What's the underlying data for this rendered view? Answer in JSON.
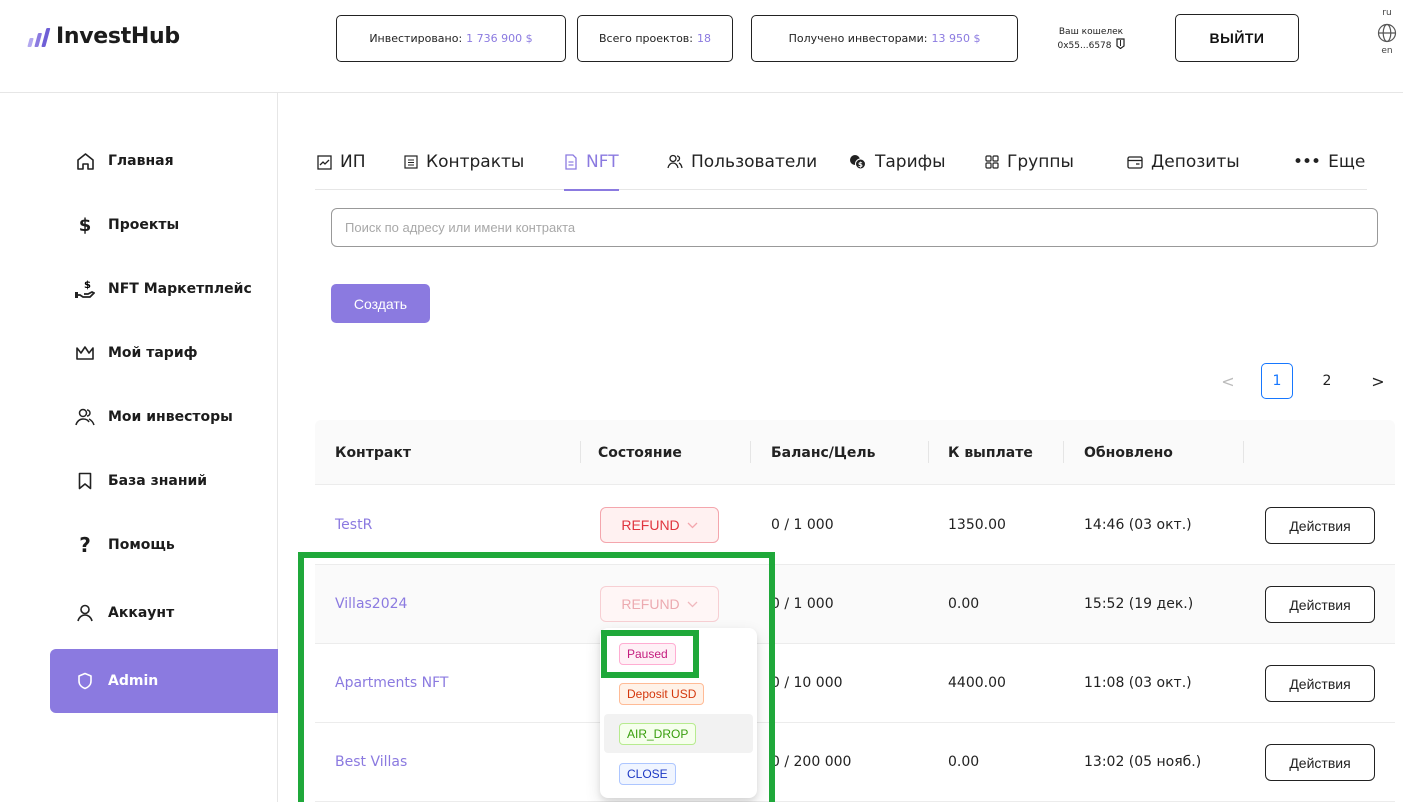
{
  "brand": {
    "name": "InvestHub"
  },
  "header": {
    "stats": {
      "invested_label": "Инвестировано:",
      "invested_value": "1 736 900 $",
      "projects_label": "Всего проектов:",
      "projects_value": "18",
      "received_label": "Получено инвесторами:",
      "received_value": "13 950 $"
    },
    "wallet": {
      "label": "Ваш кошелек",
      "address": "0x55...6578"
    },
    "logout_label": "ВЫЙТИ",
    "lang": {
      "top": "ru",
      "bottom": "en"
    }
  },
  "sidebar": {
    "items": [
      {
        "label": "Главная",
        "icon": "home-icon"
      },
      {
        "label": "Проекты",
        "icon": "dollar-icon"
      },
      {
        "label": "NFT Маркетплейс",
        "icon": "hand-coin-icon"
      },
      {
        "label": "Мой тариф",
        "icon": "crown-icon"
      },
      {
        "label": "Мои инвесторы",
        "icon": "users-icon"
      },
      {
        "label": "База знаний",
        "icon": "bookmark-icon"
      },
      {
        "label": "Помощь",
        "icon": "question-icon"
      },
      {
        "label": "Аккаунт",
        "icon": "user-icon"
      },
      {
        "label": "Admin",
        "icon": "shield-icon",
        "active": true
      }
    ]
  },
  "tabs": [
    {
      "label": "ИП",
      "icon": "chart-icon"
    },
    {
      "label": "Контракты",
      "icon": "contract-icon"
    },
    {
      "label": "NFT",
      "icon": "document-icon",
      "active": true
    },
    {
      "label": "Пользователи",
      "icon": "users-icon"
    },
    {
      "label": "Тарифы",
      "icon": "coins-icon"
    },
    {
      "label": "Группы",
      "icon": "grid-icon"
    },
    {
      "label": "Депозиты",
      "icon": "wallet-icon"
    },
    {
      "label": "Еще",
      "icon": "ellipsis-icon"
    }
  ],
  "search": {
    "placeholder": "Поиск по адресу или имени контракта",
    "value": ""
  },
  "create_label": "Создать",
  "pagination": {
    "pages": [
      "1",
      "2"
    ],
    "current": "1"
  },
  "table": {
    "columns": [
      "Контракт",
      "Состояние",
      "Баланс/Цель",
      "К выплате",
      "Обновлено"
    ],
    "rows": [
      {
        "contract": "TestR",
        "state": "REFUND",
        "balance": "0 / 1 000",
        "payout": "1350.00",
        "updated": "14:46 (03 окт.)",
        "action": "Действия"
      },
      {
        "contract": "Villas2024",
        "state": "REFUND",
        "balance": "0 / 1 000",
        "payout": "0.00",
        "updated": "15:52 (19 дек.)",
        "action": "Действия"
      },
      {
        "contract": "Apartments NFT",
        "state": "",
        "balance": "0 / 10 000",
        "payout": "4400.00",
        "updated": "11:08 (03 окт.)",
        "action": "Действия"
      },
      {
        "contract": "Best Villas",
        "state": "",
        "balance": "0 / 200 000",
        "payout": "0.00",
        "updated": "13:02 (05 нояб.)",
        "action": "Действия"
      }
    ]
  },
  "state_dropdown": {
    "options": [
      "Paused",
      "Deposit USD",
      "AIR_DROP",
      "CLOSE"
    ],
    "hovered": "AIR_DROP"
  },
  "colors": {
    "accent": "#8b7ae0",
    "refund": "#e0353f",
    "highlight": "#1fa83a",
    "page_link": "#1677ff"
  }
}
